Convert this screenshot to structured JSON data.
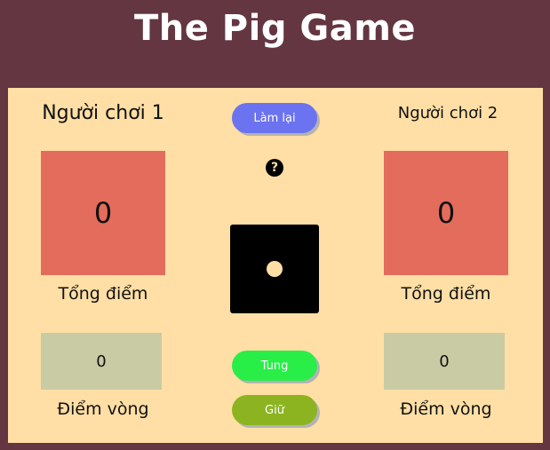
{
  "app": {
    "title": "The Pig Game"
  },
  "players": [
    {
      "name": "Người chơi 1",
      "total_score": "0",
      "total_label": "Tổng điểm",
      "round_score": "0",
      "round_label": "Điểm vòng"
    },
    {
      "name": "Người chơi 2",
      "total_score": "0",
      "total_label": "Tổng điểm",
      "round_score": "0",
      "round_label": "Điểm vòng"
    }
  ],
  "controls": {
    "reset_label": "Làm lại",
    "roll_label": "Tung",
    "hold_label": "Giữ"
  },
  "dice": {
    "value": 1
  },
  "icons": {
    "help": "question-circle-icon"
  },
  "colors": {
    "background": "#643641",
    "board": "#ffdfa5",
    "total_box": "#e36c5c",
    "round_box": "#c9cba4",
    "reset_button": "#6c73f0",
    "roll_button": "#29ee48",
    "hold_button": "#8bb420",
    "dice": "#000000"
  }
}
